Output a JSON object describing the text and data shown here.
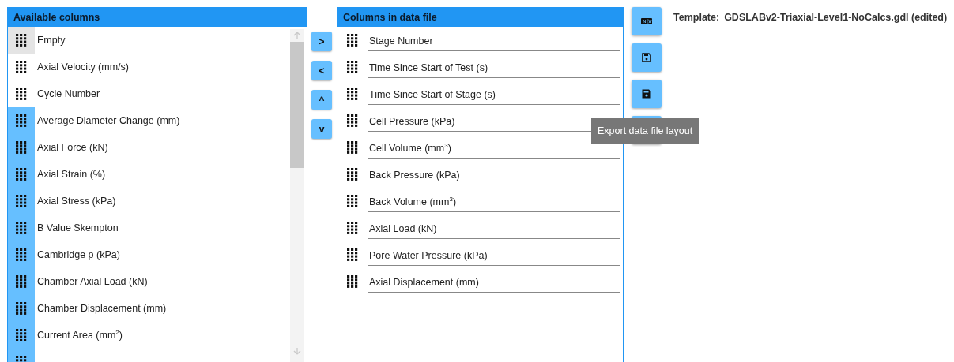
{
  "available": {
    "title": "Available columns",
    "items": [
      {
        "label": "Empty",
        "selected": false,
        "hovered": true
      },
      {
        "label": "Axial Velocity (mm/s)",
        "selected": false,
        "hovered": false
      },
      {
        "label": "Cycle Number",
        "selected": false,
        "hovered": false
      },
      {
        "label": "Average Diameter Change (mm)",
        "selected": true,
        "hovered": false
      },
      {
        "label": "Axial Force (kN)",
        "selected": true,
        "hovered": false
      },
      {
        "label": "Axial Strain (%)",
        "selected": true,
        "hovered": false
      },
      {
        "label": "Axial Stress (kPa)",
        "selected": true,
        "hovered": false
      },
      {
        "label": "B Value Skempton",
        "selected": true,
        "hovered": false
      },
      {
        "label": "Cambridge p (kPa)",
        "selected": true,
        "hovered": false
      },
      {
        "label": "Chamber Axial Load (kN)",
        "selected": true,
        "hovered": false
      },
      {
        "label": "Chamber Displacement (mm)",
        "selected": true,
        "hovered": false
      },
      {
        "label": "Current Area (mm$^{2}$)",
        "selected": true,
        "hovered": false
      },
      {
        "selected": true,
        "hovered": false
      }
    ]
  },
  "move_buttons": [
    ">",
    "<",
    "^",
    "v"
  ],
  "data_file": {
    "title": "Columns in data file",
    "items": [
      "Stage Number",
      "Time Since Start of Test (s)",
      "Time Since Start of Stage (s)",
      "Cell Pressure (kPa)",
      "Cell Volume (mm$^{3}$)",
      "Back Pressure (kPa)",
      "Back Volume (mm$^{3}$)",
      "Axial Load (kN)",
      "Pore Water Pressure (kPa)",
      "Axial Displacement (mm)"
    ]
  },
  "tool_buttons": [
    {
      "kind": "new"
    },
    {
      "kind": "save-outline"
    },
    {
      "kind": "save"
    },
    {
      "kind": "hidden"
    }
  ],
  "tooltip": "Export data file layout",
  "template": {
    "label": "Template:",
    "value": "GDSLABv2-Triaxial-Level1-NoCalcs.gdl (edited)"
  }
}
